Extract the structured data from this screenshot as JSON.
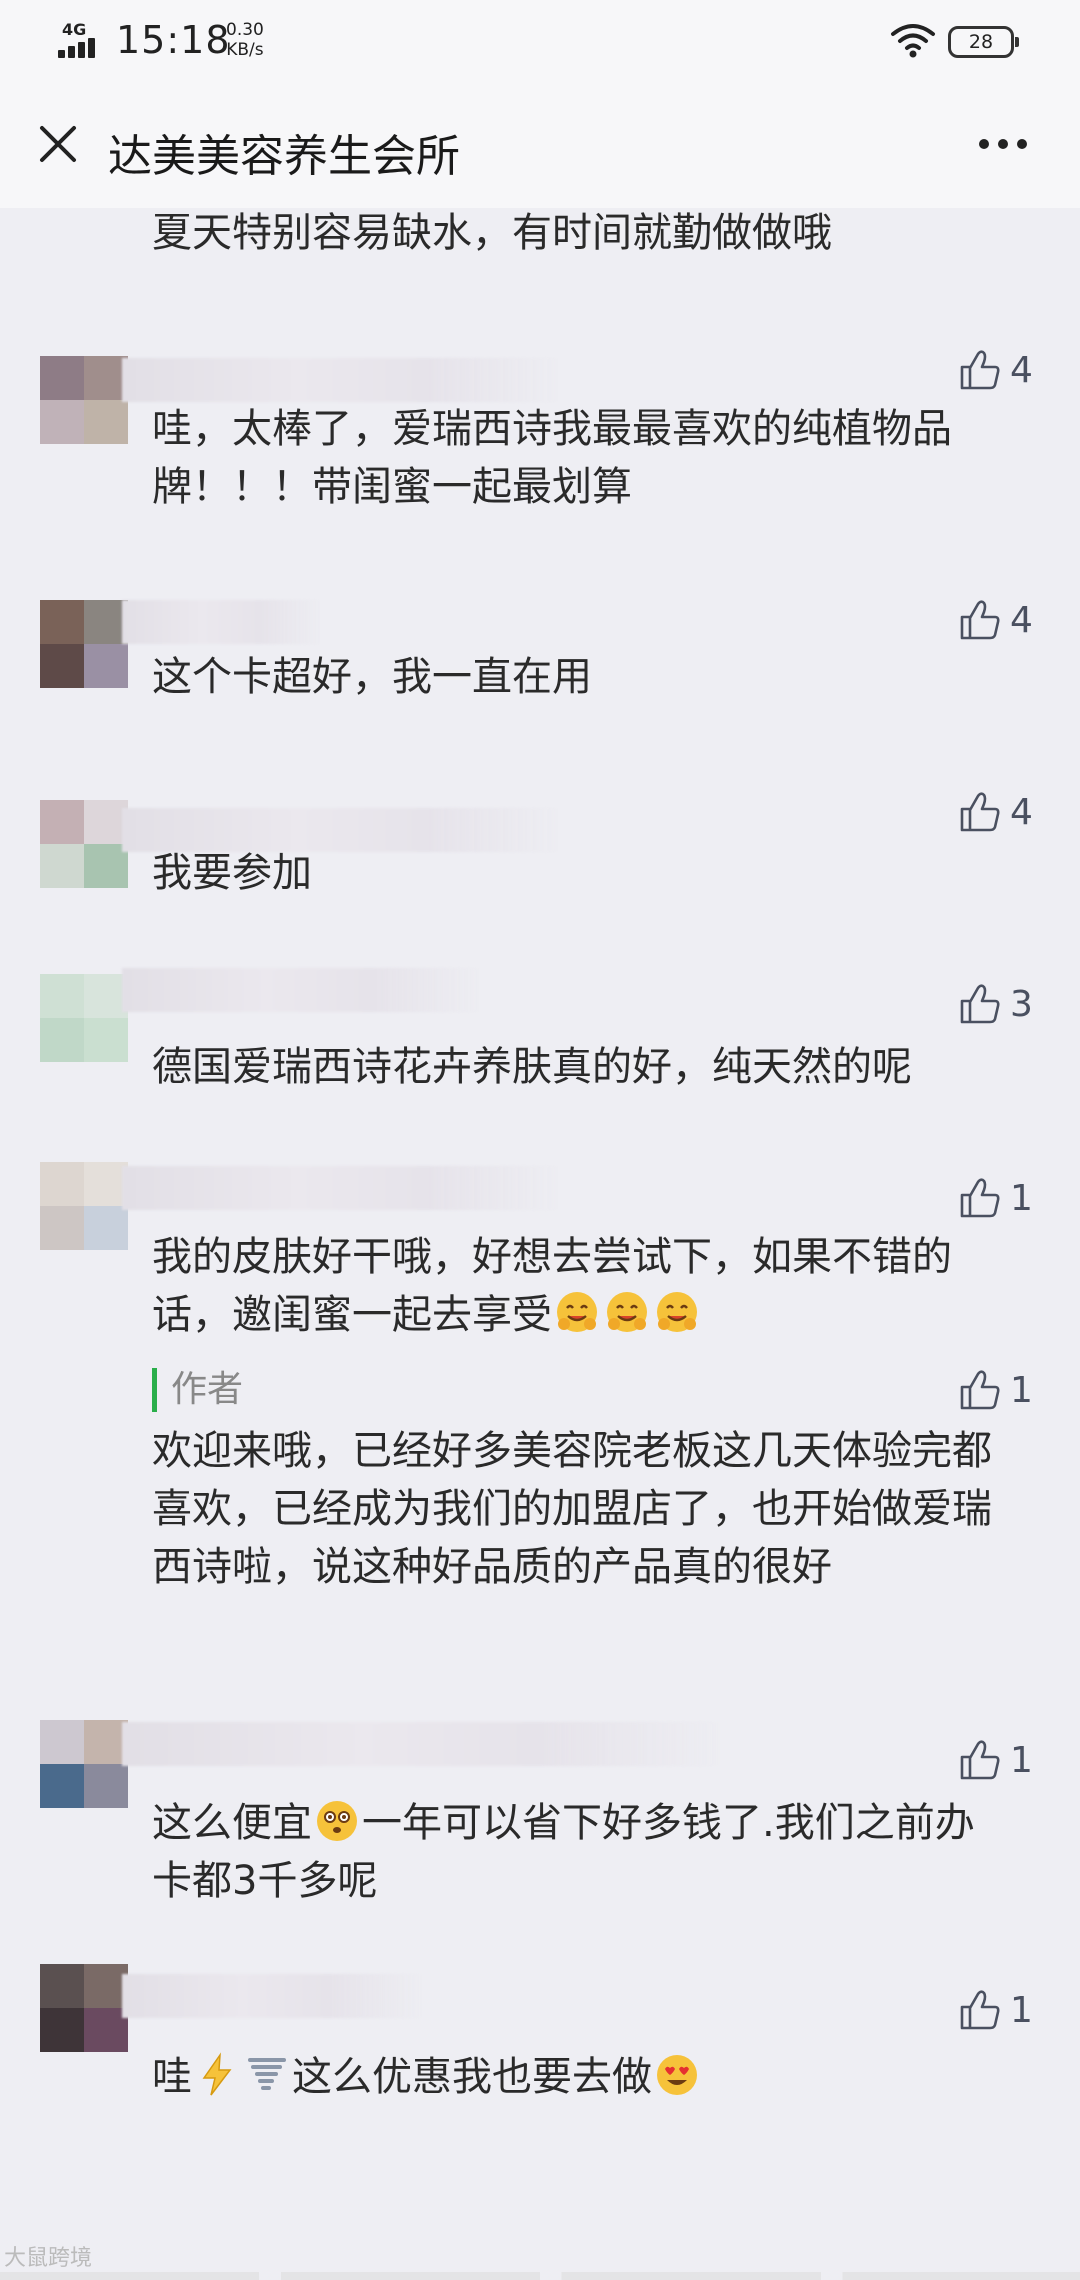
{
  "statusbar": {
    "network": "4G",
    "time": "15:18",
    "speed_value": "0.30",
    "speed_unit": "KB/s",
    "battery": "28"
  },
  "header": {
    "title": "达美美容养生会所"
  },
  "comments": [
    {
      "text": "夏天特别容易缺水，有时间就勤做做哦"
    },
    {
      "text": "哇，太棒了，爱瑞西诗我最最喜欢的纯植物品牌！！！带闺蜜一起最划算",
      "likes": "4"
    },
    {
      "text": "这个卡超好，我一直在用",
      "likes": "4"
    },
    {
      "text": "我要参加",
      "likes": "4"
    },
    {
      "text": "德国爱瑞西诗花卉养肤真的好，纯天然的呢",
      "likes": "3"
    },
    {
      "text": "我的皮肤好干哦，好想去尝试下，如果不错的话，邀闺蜜一起去享受",
      "likes": "1"
    },
    {
      "author_label": "作者",
      "text": "欢迎来哦，已经好多美容院老板这几天体验完都喜欢，已经成为我们的加盟店了，也开始做爱瑞西诗啦，说这种好品质的产品真的很好",
      "likes": "1"
    },
    {
      "text_a": "这么便宜",
      "text_b": "一年可以省下好多钱了.我们之前办卡都3千多呢",
      "likes": "1"
    },
    {
      "text_a": "哇",
      "text_b": "这么优惠我也要去做",
      "likes": "1"
    }
  ],
  "watermark": "大鼠跨境",
  "icons": {
    "close": "close-icon",
    "more": "more-icon",
    "like": "thumbs-up-icon",
    "emoji": "hugging-face-emoji"
  },
  "colors": {
    "background": "#eeeef3",
    "author_bar": "#2aae4a"
  }
}
